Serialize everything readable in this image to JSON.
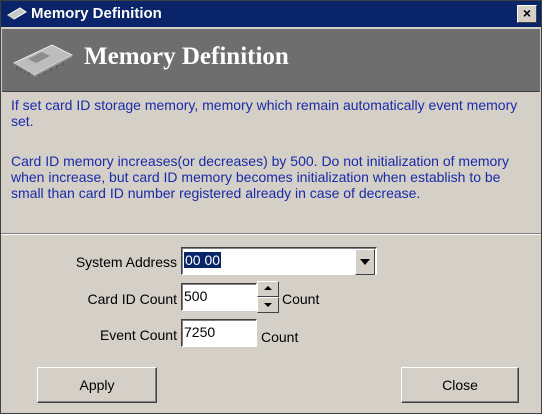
{
  "window": {
    "title": "Memory Definition",
    "close_symbol": "×"
  },
  "banner": {
    "title": "Memory Definition",
    "icon": "memory-chip-icon"
  },
  "description": {
    "para1": "If set card ID storage memory, memory which remain automatically event memory set.",
    "para2": "Card ID memory increases(or decreases) by 500. Do not initialization of memory when increase, but card ID memory becomes initialization when establish to be small than card ID number registered already in case of decrease."
  },
  "form": {
    "system_address": {
      "label": "System Address",
      "value": "00 00"
    },
    "card_id_count": {
      "label": "Card ID Count",
      "value": "500",
      "unit": "Count"
    },
    "event_count": {
      "label": "Event Count",
      "value": "7250",
      "unit": "Count"
    }
  },
  "buttons": {
    "apply": "Apply",
    "close": "Close"
  },
  "colors": {
    "title_bar": "#0a246a",
    "banner": "#6f6e6e",
    "description_text": "#1a2aa8",
    "dialog_bg": "#d4d0c8"
  }
}
